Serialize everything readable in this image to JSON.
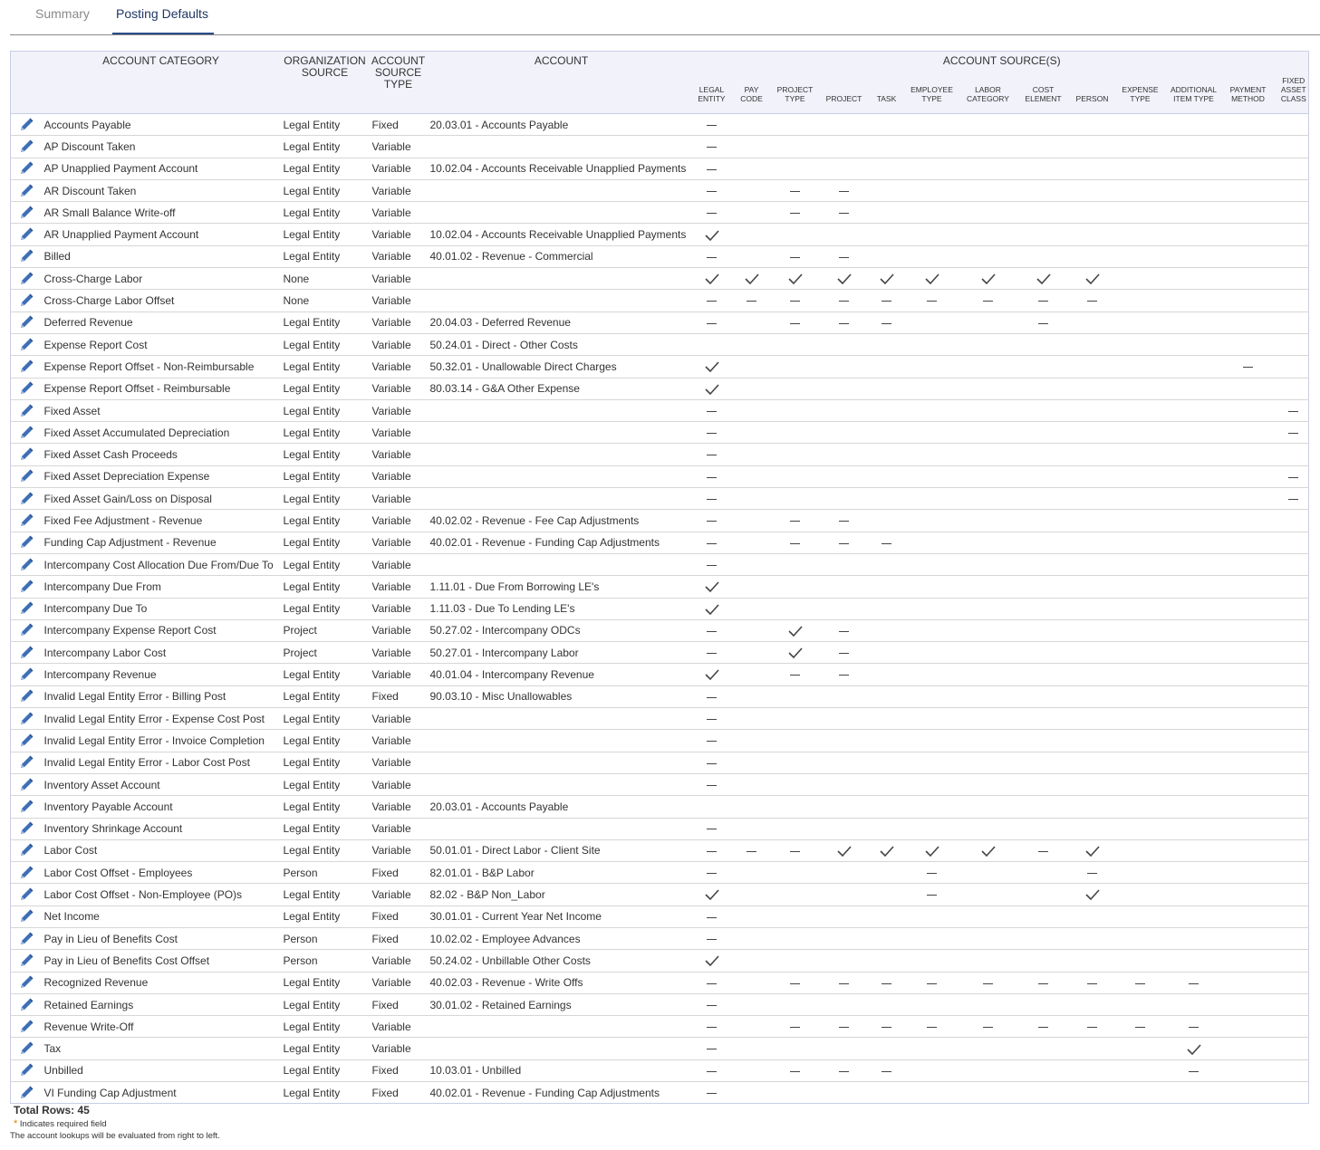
{
  "tabs": [
    {
      "label": "Summary",
      "active": false
    },
    {
      "label": "Posting Defaults",
      "active": true
    }
  ],
  "headers": {
    "account_category": "ACCOUNT CATEGORY",
    "organization_source": [
      "ORGANIZATION",
      "SOURCE"
    ],
    "account_source_type": [
      "ACCOUNT",
      "SOURCE",
      "TYPE"
    ],
    "account": "ACCOUNT",
    "account_sources_group": "ACCOUNT SOURCE(S)",
    "sources": [
      [
        "LEGAL",
        "ENTITY"
      ],
      [
        "PAY",
        "CODE"
      ],
      [
        "PROJECT",
        "TYPE"
      ],
      [
        "PROJECT"
      ],
      [
        "TASK"
      ],
      [
        "EMPLOYEE",
        "TYPE"
      ],
      [
        "LABOR",
        "CATEGORY"
      ],
      [
        "COST",
        "ELEMENT"
      ],
      [
        "PERSON"
      ],
      [
        "EXPENSE",
        "TYPE"
      ],
      [
        "ADDITIONAL",
        "ITEM TYPE"
      ],
      [
        "PAYMENT",
        "METHOD"
      ],
      [
        "FIXED",
        "ASSET",
        "CLASS"
      ]
    ]
  },
  "icons": {
    "edit": "pencil-icon",
    "check": "check-icon",
    "dash": "dash-icon"
  },
  "colors": {
    "header_bg": "#f1f2fa",
    "border": "#c9cde6",
    "pencil": "#3d6fb6",
    "tab_active_underline": "#2a4c8a"
  },
  "rows": [
    {
      "category": "Accounts Payable",
      "org": "Legal Entity",
      "type": "Fixed",
      "account": "20.03.01 - Accounts Payable",
      "src": [
        "-",
        "",
        "",
        "",
        "",
        "",
        "",
        "",
        "",
        "",
        "",
        "",
        ""
      ]
    },
    {
      "category": "AP Discount Taken",
      "org": "Legal Entity",
      "type": "Variable",
      "account": "",
      "src": [
        "-",
        "",
        "",
        "",
        "",
        "",
        "",
        "",
        "",
        "",
        "",
        "",
        ""
      ]
    },
    {
      "category": "AP Unapplied Payment Account",
      "org": "Legal Entity",
      "type": "Variable",
      "account": "10.02.04 - Accounts Receivable Unapplied Payments",
      "src": [
        "-",
        "",
        "",
        "",
        "",
        "",
        "",
        "",
        "",
        "",
        "",
        "",
        ""
      ]
    },
    {
      "category": "AR Discount Taken",
      "org": "Legal Entity",
      "type": "Variable",
      "account": "",
      "src": [
        "-",
        "",
        "-",
        "-",
        "",
        "",
        "",
        "",
        "",
        "",
        "",
        "",
        ""
      ]
    },
    {
      "category": "AR Small Balance Write-off",
      "org": "Legal Entity",
      "type": "Variable",
      "account": "",
      "src": [
        "-",
        "",
        "-",
        "-",
        "",
        "",
        "",
        "",
        "",
        "",
        "",
        "",
        ""
      ]
    },
    {
      "category": "AR Unapplied Payment Account",
      "org": "Legal Entity",
      "type": "Variable",
      "account": "10.02.04 - Accounts Receivable Unapplied Payments",
      "src": [
        "v",
        "",
        "",
        "",
        "",
        "",
        "",
        "",
        "",
        "",
        "",
        "",
        ""
      ]
    },
    {
      "category": "Billed",
      "org": "Legal Entity",
      "type": "Variable",
      "account": "40.01.02 - Revenue - Commercial",
      "src": [
        "-",
        "",
        "-",
        "-",
        "",
        "",
        "",
        "",
        "",
        "",
        "",
        "",
        ""
      ]
    },
    {
      "category": "Cross-Charge Labor",
      "org": "None",
      "type": "Variable",
      "account": "",
      "src": [
        "v",
        "v",
        "v",
        "v",
        "v",
        "v",
        "v",
        "v",
        "v",
        "",
        "",
        "",
        ""
      ]
    },
    {
      "category": "Cross-Charge Labor Offset",
      "org": "None",
      "type": "Variable",
      "account": "",
      "src": [
        "-",
        "-",
        "-",
        "-",
        "-",
        "-",
        "-",
        "-",
        "-",
        "",
        "",
        "",
        ""
      ]
    },
    {
      "category": "Deferred Revenue",
      "org": "Legal Entity",
      "type": "Variable",
      "account": "20.04.03 - Deferred Revenue",
      "src": [
        "-",
        "",
        "-",
        "-",
        "-",
        "",
        "",
        "-",
        "",
        "",
        "",
        "",
        ""
      ]
    },
    {
      "category": "Expense Report Cost",
      "org": "Legal Entity",
      "type": "Variable",
      "account": "50.24.01 - Direct - Other Costs",
      "src": [
        "",
        "",
        "",
        "",
        "",
        "",
        "",
        "",
        "",
        "",
        "",
        "",
        ""
      ]
    },
    {
      "category": "Expense Report Offset - Non-Reimbursable",
      "org": "Legal Entity",
      "type": "Variable",
      "account": "50.32.01 - Unallowable Direct Charges",
      "src": [
        "v",
        "",
        "",
        "",
        "",
        "",
        "",
        "",
        "",
        "",
        "",
        "-",
        ""
      ]
    },
    {
      "category": "Expense Report Offset - Reimbursable",
      "org": "Legal Entity",
      "type": "Variable",
      "account": "80.03.14 - G&A Other Expense",
      "src": [
        "v",
        "",
        "",
        "",
        "",
        "",
        "",
        "",
        "",
        "",
        "",
        "",
        ""
      ]
    },
    {
      "category": "Fixed Asset",
      "org": "Legal Entity",
      "type": "Variable",
      "account": "",
      "src": [
        "-",
        "",
        "",
        "",
        "",
        "",
        "",
        "",
        "",
        "",
        "",
        "",
        "-"
      ]
    },
    {
      "category": "Fixed Asset Accumulated Depreciation",
      "org": "Legal Entity",
      "type": "Variable",
      "account": "",
      "src": [
        "-",
        "",
        "",
        "",
        "",
        "",
        "",
        "",
        "",
        "",
        "",
        "",
        "-"
      ]
    },
    {
      "category": "Fixed Asset Cash Proceeds",
      "org": "Legal Entity",
      "type": "Variable",
      "account": "",
      "src": [
        "-",
        "",
        "",
        "",
        "",
        "",
        "",
        "",
        "",
        "",
        "",
        "",
        ""
      ]
    },
    {
      "category": "Fixed Asset Depreciation Expense",
      "org": "Legal Entity",
      "type": "Variable",
      "account": "",
      "src": [
        "-",
        "",
        "",
        "",
        "",
        "",
        "",
        "",
        "",
        "",
        "",
        "",
        "-"
      ]
    },
    {
      "category": "Fixed Asset Gain/Loss on Disposal",
      "org": "Legal Entity",
      "type": "Variable",
      "account": "",
      "src": [
        "-",
        "",
        "",
        "",
        "",
        "",
        "",
        "",
        "",
        "",
        "",
        "",
        "-"
      ]
    },
    {
      "category": "Fixed Fee Adjustment - Revenue",
      "org": "Legal Entity",
      "type": "Variable",
      "account": "40.02.02 - Revenue - Fee Cap Adjustments",
      "src": [
        "-",
        "",
        "-",
        "-",
        "",
        "",
        "",
        "",
        "",
        "",
        "",
        "",
        ""
      ]
    },
    {
      "category": "Funding Cap Adjustment - Revenue",
      "org": "Legal Entity",
      "type": "Variable",
      "account": "40.02.01 - Revenue - Funding Cap Adjustments",
      "src": [
        "-",
        "",
        "-",
        "-",
        "-",
        "",
        "",
        "",
        "",
        "",
        "",
        "",
        ""
      ]
    },
    {
      "category": "Intercompany Cost Allocation Due From/Due To",
      "org": "Legal Entity",
      "type": "Variable",
      "account": "",
      "src": [
        "-",
        "",
        "",
        "",
        "",
        "",
        "",
        "",
        "",
        "",
        "",
        "",
        ""
      ]
    },
    {
      "category": "Intercompany Due From",
      "org": "Legal Entity",
      "type": "Variable",
      "account": "1.11.01 - Due From Borrowing LE's",
      "src": [
        "v",
        "",
        "",
        "",
        "",
        "",
        "",
        "",
        "",
        "",
        "",
        "",
        ""
      ]
    },
    {
      "category": "Intercompany Due To",
      "org": "Legal Entity",
      "type": "Variable",
      "account": "1.11.03 - Due To Lending LE's",
      "src": [
        "v",
        "",
        "",
        "",
        "",
        "",
        "",
        "",
        "",
        "",
        "",
        "",
        ""
      ]
    },
    {
      "category": "Intercompany Expense Report Cost",
      "org": "Project",
      "type": "Variable",
      "account": "50.27.02 - Intercompany ODCs",
      "src": [
        "-",
        "",
        "v",
        "-",
        "",
        "",
        "",
        "",
        "",
        "",
        "",
        "",
        ""
      ]
    },
    {
      "category": "Intercompany Labor Cost",
      "org": "Project",
      "type": "Variable",
      "account": "50.27.01 - Intercompany Labor",
      "src": [
        "-",
        "",
        "v",
        "-",
        "",
        "",
        "",
        "",
        "",
        "",
        "",
        "",
        ""
      ]
    },
    {
      "category": "Intercompany Revenue",
      "org": "Legal Entity",
      "type": "Variable",
      "account": "40.01.04 - Intercompany Revenue",
      "src": [
        "v",
        "",
        "-",
        "-",
        "",
        "",
        "",
        "",
        "",
        "",
        "",
        "",
        ""
      ]
    },
    {
      "category": "Invalid Legal Entity Error - Billing Post",
      "org": "Legal Entity",
      "type": "Fixed",
      "account": "90.03.10 - Misc Unallowables",
      "src": [
        "-",
        "",
        "",
        "",
        "",
        "",
        "",
        "",
        "",
        "",
        "",
        "",
        ""
      ]
    },
    {
      "category": "Invalid Legal Entity Error - Expense Cost Post",
      "org": "Legal Entity",
      "type": "Variable",
      "account": "",
      "src": [
        "-",
        "",
        "",
        "",
        "",
        "",
        "",
        "",
        "",
        "",
        "",
        "",
        ""
      ]
    },
    {
      "category": "Invalid Legal Entity Error - Invoice Completion",
      "org": "Legal Entity",
      "type": "Variable",
      "account": "",
      "src": [
        "-",
        "",
        "",
        "",
        "",
        "",
        "",
        "",
        "",
        "",
        "",
        "",
        ""
      ]
    },
    {
      "category": "Invalid Legal Entity Error - Labor Cost Post",
      "org": "Legal Entity",
      "type": "Variable",
      "account": "",
      "src": [
        "-",
        "",
        "",
        "",
        "",
        "",
        "",
        "",
        "",
        "",
        "",
        "",
        ""
      ]
    },
    {
      "category": "Inventory Asset Account",
      "org": "Legal Entity",
      "type": "Variable",
      "account": "",
      "src": [
        "-",
        "",
        "",
        "",
        "",
        "",
        "",
        "",
        "",
        "",
        "",
        "",
        ""
      ]
    },
    {
      "category": "Inventory Payable Account",
      "org": "Legal Entity",
      "type": "Variable",
      "account": "20.03.01 - Accounts Payable",
      "src": [
        "",
        "",
        "",
        "",
        "",
        "",
        "",
        "",
        "",
        "",
        "",
        "",
        ""
      ]
    },
    {
      "category": "Inventory Shrinkage Account",
      "org": "Legal Entity",
      "type": "Variable",
      "account": "",
      "src": [
        "-",
        "",
        "",
        "",
        "",
        "",
        "",
        "",
        "",
        "",
        "",
        "",
        ""
      ]
    },
    {
      "category": "Labor Cost",
      "org": "Legal Entity",
      "type": "Variable",
      "account": "50.01.01 - Direct Labor - Client Site",
      "src": [
        "-",
        "-",
        "-",
        "v",
        "v",
        "v",
        "v",
        "-",
        "v",
        "",
        "",
        "",
        ""
      ]
    },
    {
      "category": "Labor Cost Offset - Employees",
      "org": "Person",
      "type": "Fixed",
      "account": "82.01.01 - B&P Labor",
      "src": [
        "-",
        "",
        "",
        "",
        "",
        "-",
        "",
        "",
        "-",
        "",
        "",
        "",
        ""
      ]
    },
    {
      "category": "Labor Cost Offset - Non-Employee (PO)s",
      "org": "Legal Entity",
      "type": "Variable",
      "account": "82.02 - B&P Non_Labor",
      "src": [
        "v",
        "",
        "",
        "",
        "",
        "-",
        "",
        "",
        "v",
        "",
        "",
        "",
        ""
      ]
    },
    {
      "category": "Net Income",
      "org": "Legal Entity",
      "type": "Fixed",
      "account": "30.01.01 - Current Year Net Income",
      "src": [
        "-",
        "",
        "",
        "",
        "",
        "",
        "",
        "",
        "",
        "",
        "",
        "",
        ""
      ]
    },
    {
      "category": "Pay in Lieu of Benefits Cost",
      "org": "Person",
      "type": "Fixed",
      "account": "10.02.02 - Employee Advances",
      "src": [
        "-",
        "",
        "",
        "",
        "",
        "",
        "",
        "",
        "",
        "",
        "",
        "",
        ""
      ]
    },
    {
      "category": "Pay in Lieu of Benefits Cost Offset",
      "org": "Person",
      "type": "Variable",
      "account": "50.24.02 - Unbillable Other Costs",
      "src": [
        "v",
        "",
        "",
        "",
        "",
        "",
        "",
        "",
        "",
        "",
        "",
        "",
        ""
      ]
    },
    {
      "category": "Recognized Revenue",
      "org": "Legal Entity",
      "type": "Variable",
      "account": "40.02.03 - Revenue - Write Offs",
      "src": [
        "-",
        "",
        "-",
        "-",
        "-",
        "-",
        "-",
        "-",
        "-",
        "-",
        "-",
        "",
        ""
      ]
    },
    {
      "category": "Retained Earnings",
      "org": "Legal Entity",
      "type": "Fixed",
      "account": "30.01.02 - Retained Earnings",
      "src": [
        "-",
        "",
        "",
        "",
        "",
        "",
        "",
        "",
        "",
        "",
        "",
        "",
        ""
      ]
    },
    {
      "category": "Revenue Write-Off",
      "org": "Legal Entity",
      "type": "Variable",
      "account": "",
      "src": [
        "-",
        "",
        "-",
        "-",
        "-",
        "-",
        "-",
        "-",
        "-",
        "-",
        "-",
        "",
        ""
      ]
    },
    {
      "category": "Tax",
      "org": "Legal Entity",
      "type": "Variable",
      "account": "",
      "src": [
        "-",
        "",
        "",
        "",
        "",
        "",
        "",
        "",
        "",
        "",
        "v",
        "",
        ""
      ]
    },
    {
      "category": "Unbilled",
      "org": "Legal Entity",
      "type": "Fixed",
      "account": "10.03.01 - Unbilled",
      "src": [
        "-",
        "",
        "-",
        "-",
        "-",
        "",
        "",
        "",
        "",
        "",
        "-",
        "",
        ""
      ]
    },
    {
      "category": "VI Funding Cap Adjustment",
      "org": "Legal Entity",
      "type": "Fixed",
      "account": "40.02.01 - Revenue - Funding Cap Adjustments",
      "src": [
        "-",
        "",
        "",
        "",
        "",
        "",
        "",
        "",
        "",
        "",
        "",
        "",
        ""
      ]
    }
  ],
  "footer": {
    "total_rows": "Total Rows: 45",
    "required_star": "*",
    "required_text": "Indicates required field",
    "note": "The account lookups will be evaluated from right to left."
  }
}
